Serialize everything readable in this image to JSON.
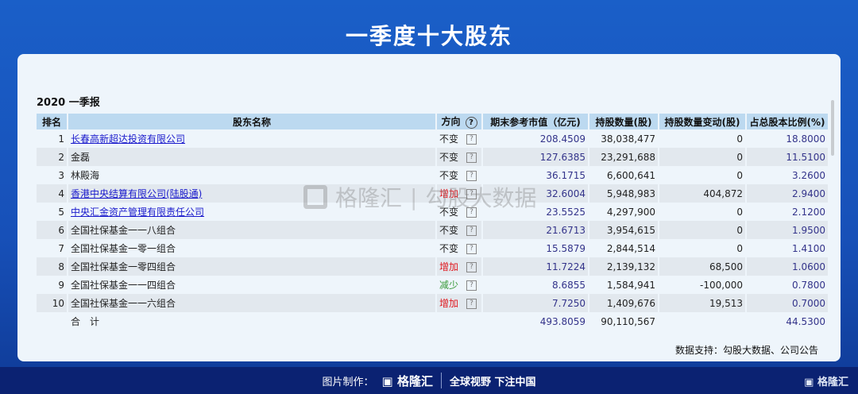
{
  "title": "一季度十大股东",
  "period": "2020 一季报",
  "headers": {
    "rank": "排名",
    "name": "股东名称",
    "direction": "方向",
    "help": "?",
    "mv": "期末参考市值（亿元)",
    "shares": "持股数量(股)",
    "change": "持股数量变动(股)",
    "pct": "占总股本比例(%)"
  },
  "rows": [
    {
      "rank": "1",
      "name": "长春高新超达投资有限公司",
      "link": true,
      "dir": "不变",
      "dirType": "same",
      "mv": "208.4509",
      "shares": "38,038,477",
      "change": "0",
      "pct": "18.8000"
    },
    {
      "rank": "2",
      "name": "金磊",
      "link": false,
      "dir": "不变",
      "dirType": "same",
      "mv": "127.6385",
      "shares": "23,291,688",
      "change": "0",
      "pct": "11.5100"
    },
    {
      "rank": "3",
      "name": "林殿海",
      "link": false,
      "dir": "不变",
      "dirType": "same",
      "mv": "36.1715",
      "shares": "6,600,641",
      "change": "0",
      "pct": "3.2600"
    },
    {
      "rank": "4",
      "name": "香港中央结算有限公司(陆股通)",
      "link": true,
      "dir": "增加",
      "dirType": "up",
      "mv": "32.6004",
      "shares": "5,948,983",
      "change": "404,872",
      "pct": "2.9400"
    },
    {
      "rank": "5",
      "name": "中央汇金资产管理有限责任公司",
      "link": true,
      "dir": "不变",
      "dirType": "same",
      "mv": "23.5525",
      "shares": "4,297,900",
      "change": "0",
      "pct": "2.1200"
    },
    {
      "rank": "6",
      "name": "全国社保基金一一八组合",
      "link": false,
      "dir": "不变",
      "dirType": "same",
      "mv": "21.6713",
      "shares": "3,954,615",
      "change": "0",
      "pct": "1.9500"
    },
    {
      "rank": "7",
      "name": "全国社保基金一零一组合",
      "link": false,
      "dir": "不变",
      "dirType": "same",
      "mv": "15.5879",
      "shares": "2,844,514",
      "change": "0",
      "pct": "1.4100"
    },
    {
      "rank": "8",
      "name": "全国社保基金一零四组合",
      "link": false,
      "dir": "增加",
      "dirType": "up",
      "mv": "11.7224",
      "shares": "2,139,132",
      "change": "68,500",
      "pct": "1.0600"
    },
    {
      "rank": "9",
      "name": "全国社保基金一一四组合",
      "link": false,
      "dir": "减少",
      "dirType": "down",
      "mv": "8.6855",
      "shares": "1,584,941",
      "change": "-100,000",
      "pct": "0.7800"
    },
    {
      "rank": "10",
      "name": "全国社保基金一一六组合",
      "link": false,
      "dir": "增加",
      "dirType": "up",
      "mv": "7.7250",
      "shares": "1,409,676",
      "change": "19,513",
      "pct": "0.7000"
    }
  ],
  "total": {
    "label": "合　计",
    "mv": "493.8059",
    "shares": "90,110,567",
    "pct": "44.5300"
  },
  "source": "数据支持：勾股大数据、公司公告",
  "watermark": {
    "brand": "格隆汇",
    "product": "勾股大数据"
  },
  "footer": {
    "made_by": "图片制作：",
    "brand": "格隆汇",
    "slogan": "全球视野 下注中国"
  },
  "corner_brand": "格隆汇"
}
